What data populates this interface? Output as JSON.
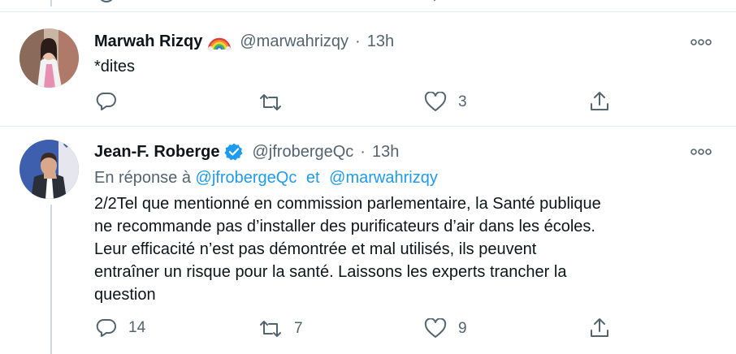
{
  "tweets": [
    {
      "name": "Marwah Rizqy",
      "emoji": "rainbow-flag-icon",
      "handle": "@marwahrizqy",
      "separator": "·",
      "time": "13h",
      "text": "*dites",
      "actions": {
        "reply": "",
        "retweet": "",
        "like": "3"
      }
    },
    {
      "name": "Jean-F. Roberge",
      "verified": true,
      "handle": "@jfrobergeQc",
      "separator": "·",
      "time": "13h",
      "reply_prefix": "En réponse à",
      "reply_user1": "@jfrobergeQc",
      "reply_connector": "et",
      "reply_user2": "@marwahrizqy",
      "text_lines": [
        "2/2Tel que mentionné en commission parlementaire, la Santé publique",
        "ne recommande pas d’installer des purificateurs d’air dans les écoles.",
        "Leur efficacité n’est pas démontrée et mal utilisés, ils peuvent",
        "entraîner un risque pour la santé. Laissons les experts trancher la",
        "question"
      ],
      "actions": {
        "reply": "14",
        "retweet": "7",
        "like": "9"
      }
    }
  ],
  "colors": {
    "accent": "#1d9bf0",
    "muted": "#536471",
    "text": "#0f1419",
    "divider": "#e6ecf0"
  }
}
